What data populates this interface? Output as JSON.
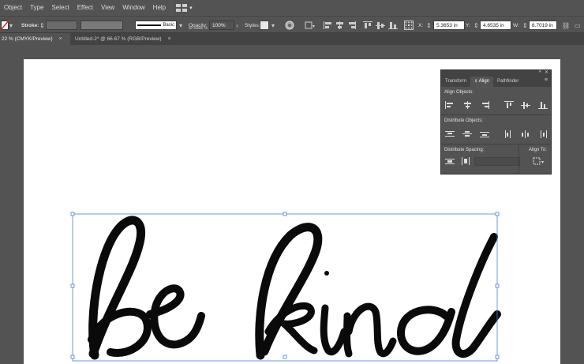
{
  "menu": [
    "Object",
    "Type",
    "Select",
    "Effect",
    "View",
    "Window",
    "Help"
  ],
  "control": {
    "stroke_label": "Stroke:",
    "brush_label": "Basic",
    "opacity_label": "Opacity:",
    "opacity_value": "100%",
    "styles_label": "Styles:",
    "x_label": "X:",
    "x_value": "5.3653 in",
    "y_label": "Y:",
    "y_value": "4.6535 in",
    "w_label": "W:",
    "w_value": "8.7019 in"
  },
  "tabs": [
    {
      "label": "22 % (CMYK/Preview)",
      "close": "×"
    },
    {
      "label": "Untitled-2* @ 66.67 % (RGB/Preview)",
      "close": "×"
    }
  ],
  "panel": {
    "tabs": [
      "Transform",
      "Align",
      "Pathfinder"
    ],
    "align_objects": "Align Objects:",
    "distribute_objects": "Distribute Objects:",
    "distribute_spacing": "Distribute Spacing:",
    "align_to": "Align To:"
  },
  "artwork_text": "be kind",
  "colors": {
    "ui_dark": "#535353",
    "ui_darker": "#434343",
    "selection": "#4a7fd8"
  }
}
